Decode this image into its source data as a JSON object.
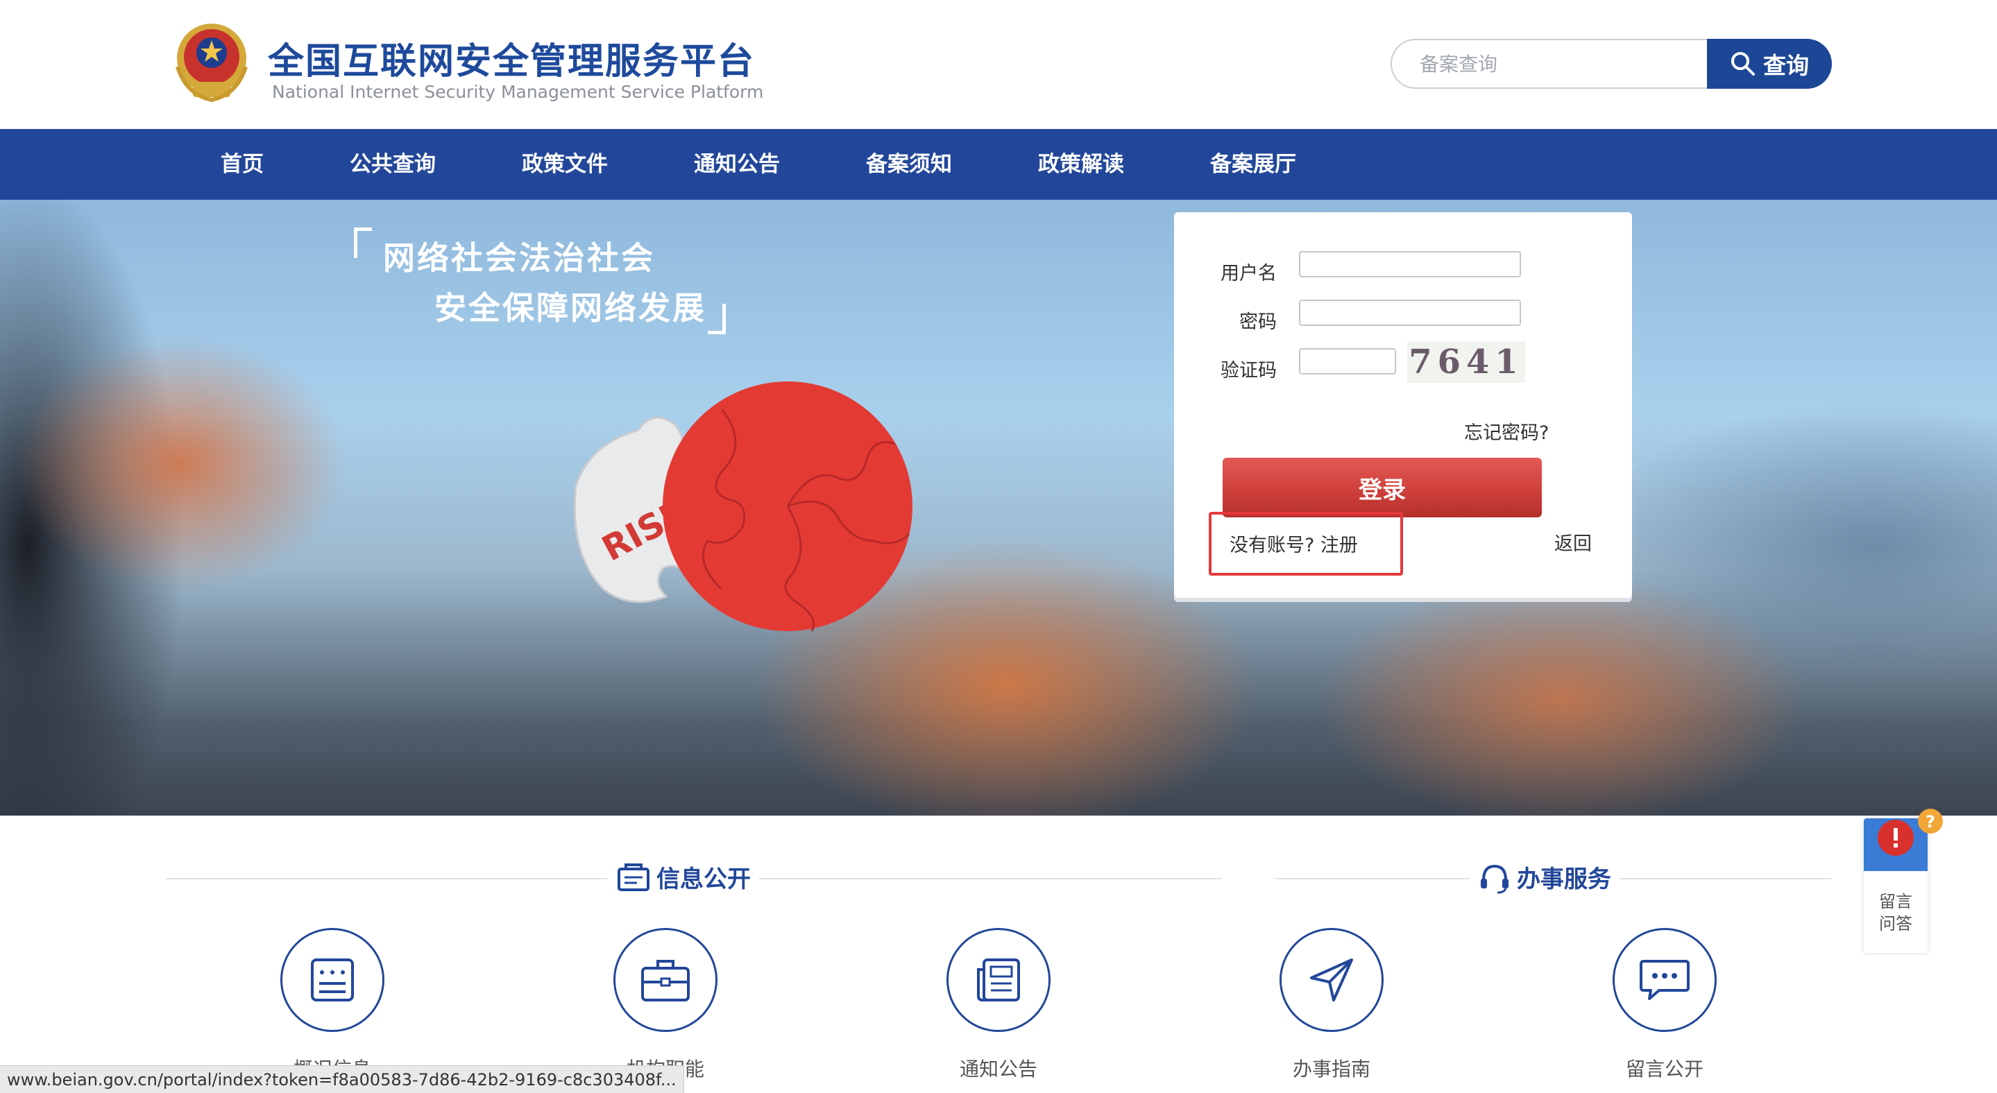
{
  "header": {
    "title": "全国互联网安全管理服务平台",
    "subtitle": "National Internet Security Management Service Platform",
    "search_placeholder": "备案查询",
    "search_button": "查询"
  },
  "nav": {
    "items": [
      "首页",
      "公共查询",
      "政策文件",
      "通知公告",
      "备案须知",
      "政策解读",
      "备案展厅"
    ]
  },
  "banner": {
    "slogan_line1": "网络社会法治社会",
    "slogan_line2": "安全保障网络发展",
    "puzzle_text": "RISK"
  },
  "login": {
    "username_label": "用户名",
    "password_label": "密码",
    "captcha_label": "验证码",
    "captcha_value": "7641",
    "forgot_password": "忘记密码?",
    "login_button": "登录",
    "register_text": "没有账号? 注册",
    "back_link": "返回"
  },
  "sections": {
    "info_title": "信息公开",
    "service_title": "办事服务",
    "items": [
      {
        "label": "概况信息",
        "icon": "document-list-icon"
      },
      {
        "label": "机构职能",
        "icon": "briefcase-icon"
      },
      {
        "label": "通知公告",
        "icon": "newspaper-icon"
      },
      {
        "label": "办事指南",
        "icon": "navigation-arrow-icon"
      },
      {
        "label": "留言公开",
        "icon": "chat-bubble-icon"
      }
    ]
  },
  "side_widget": {
    "line1": "留言",
    "line2": "问答"
  },
  "status_bar": {
    "url": "www.beian.gov.cn/portal/index?token=f8a00583-7d86-42b2-9169-c8c303408f..."
  },
  "colors": {
    "brand_blue": "#22479a",
    "login_red": "#cf3f3a",
    "highlight_red": "#e5393a"
  }
}
